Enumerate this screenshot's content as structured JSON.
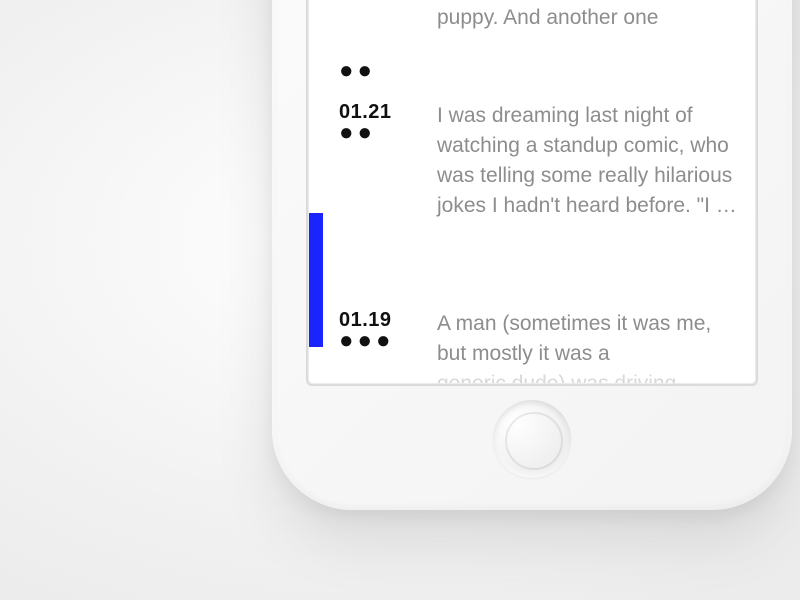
{
  "colors": {
    "accent": "#1a24ff",
    "body_text": "#8d8d8d",
    "date_text": "#111111"
  },
  "entries": [
    {
      "date": "",
      "dot_count": 2,
      "dots": "●●",
      "body_visible": "puppy. And another one"
    },
    {
      "date": "01.21",
      "dot_count": 2,
      "dots": "●●",
      "body_visible": "I was dreaming last night of watching a standup comic, who was telling some really hilarious jokes I hadn't heard before. \"I …"
    },
    {
      "date": "01.19",
      "dot_count": 3,
      "dots": "●●●",
      "body_visible": "A man (sometimes it was me, but mostly it was a",
      "body_cutoff_faint": "generic dude) was driving"
    }
  ],
  "selected_index": 2
}
